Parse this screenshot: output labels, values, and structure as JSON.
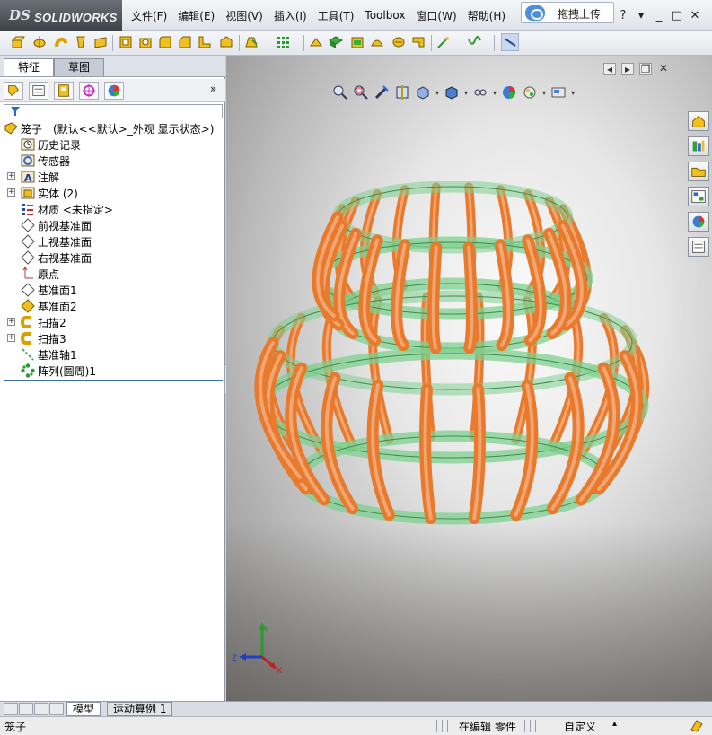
{
  "app": {
    "logo_prefix": "DS",
    "logo_name": "SOLIDWORKS"
  },
  "menu": {
    "items": [
      "文件(F)",
      "编辑(E)",
      "视图(V)",
      "插入(I)",
      "工具(T)",
      "Toolbox",
      "窗口(W)",
      "帮助(H)"
    ]
  },
  "upload_button": {
    "label": "拖拽上传"
  },
  "window_controls": {
    "help": "?",
    "dropdown": "▾",
    "minimize": "_",
    "maximize": "□",
    "close": "✕"
  },
  "panel_tabs": [
    "特征",
    "草图"
  ],
  "tree": {
    "root": "笼子　(默认<<默认>_外观 显示状态>)",
    "items": [
      {
        "label": "历史记录",
        "icon": "history-icon",
        "expandable": false
      },
      {
        "label": "传感器",
        "icon": "sensor-icon",
        "expandable": false
      },
      {
        "label": "注解",
        "icon": "annotation-icon",
        "expandable": true
      },
      {
        "label": "实体 (2)",
        "icon": "solid-bodies-icon",
        "expandable": true
      },
      {
        "label": "材质 <未指定>",
        "icon": "material-icon",
        "expandable": false
      },
      {
        "label": "前视基准面",
        "icon": "plane-icon",
        "expandable": false
      },
      {
        "label": "上视基准面",
        "icon": "plane-icon",
        "expandable": false
      },
      {
        "label": "右视基准面",
        "icon": "plane-icon",
        "expandable": false
      },
      {
        "label": "原点",
        "icon": "origin-icon",
        "expandable": false
      },
      {
        "label": "基准面1",
        "icon": "plane-icon",
        "expandable": false
      },
      {
        "label": "基准面2",
        "icon": "plane-icon-yellow",
        "expandable": false
      },
      {
        "label": "扫描2",
        "icon": "sweep-icon",
        "expandable": true
      },
      {
        "label": "扫描3",
        "icon": "sweep-icon",
        "expandable": true
      },
      {
        "label": "基准轴1",
        "icon": "axis-icon",
        "expandable": false
      },
      {
        "label": "阵列(圆周)1",
        "icon": "circular-pattern-icon",
        "expandable": false
      }
    ]
  },
  "bottom_tabs": [
    "模型",
    "运动算例 1"
  ],
  "status": {
    "document": "笼子",
    "editing": "在编辑 零件",
    "units": "自定义",
    "units_arrow": "▴"
  },
  "triad": {
    "x": "X",
    "y": "Y",
    "z": "Z"
  },
  "colors": {
    "bar": "#e87a2e",
    "ring": "#7fd08f",
    "ring_edge": "#3f8a4f",
    "accent": "#3b6db3"
  }
}
